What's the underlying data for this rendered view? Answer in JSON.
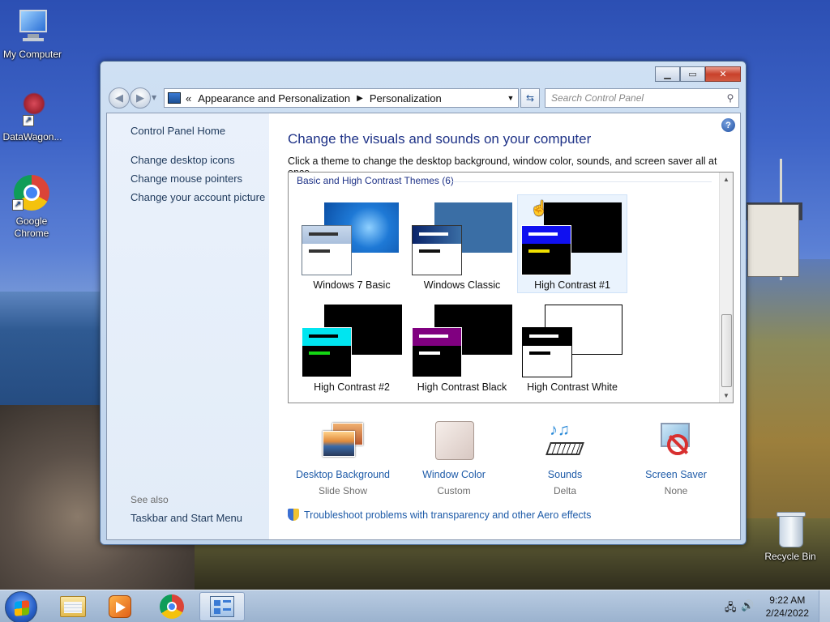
{
  "desktop": {
    "icons": [
      {
        "label": "My Computer"
      },
      {
        "label": "DataWagon..."
      },
      {
        "label": "Google Chrome"
      },
      {
        "label": "Recycle Bin"
      }
    ]
  },
  "window": {
    "address": {
      "prefix": "«",
      "crumbs": [
        "Appearance and Personalization",
        "Personalization"
      ]
    },
    "search_placeholder": "Search Control Panel",
    "left_pane": {
      "home": "Control Panel Home",
      "links": [
        "Change desktop icons",
        "Change mouse pointers",
        "Change your account picture"
      ],
      "see_also": "See also",
      "see_also_links": [
        "Taskbar and Start Menu"
      ]
    },
    "main": {
      "heading": "Change the visuals and sounds on your computer",
      "subtext": "Click a theme to change the desktop background, window color, sounds, and screen saver all at once.",
      "group_label": "Basic and High Contrast Themes (6)",
      "themes": [
        {
          "name": "Windows 7 Basic",
          "selected": false
        },
        {
          "name": "Windows Classic",
          "selected": false
        },
        {
          "name": "High Contrast #1",
          "selected": true
        },
        {
          "name": "High Contrast #2",
          "selected": false
        },
        {
          "name": "High Contrast Black",
          "selected": false
        },
        {
          "name": "High Contrast White",
          "selected": false
        }
      ],
      "settings": [
        {
          "label": "Desktop Background",
          "value": "Slide Show"
        },
        {
          "label": "Window Color",
          "value": "Custom"
        },
        {
          "label": "Sounds",
          "value": "Delta"
        },
        {
          "label": "Screen Saver",
          "value": "None"
        }
      ],
      "troubleshoot": "Troubleshoot problems with transparency and other Aero effects"
    }
  },
  "taskbar": {
    "time": "9:22 AM",
    "date": "2/24/2022"
  }
}
